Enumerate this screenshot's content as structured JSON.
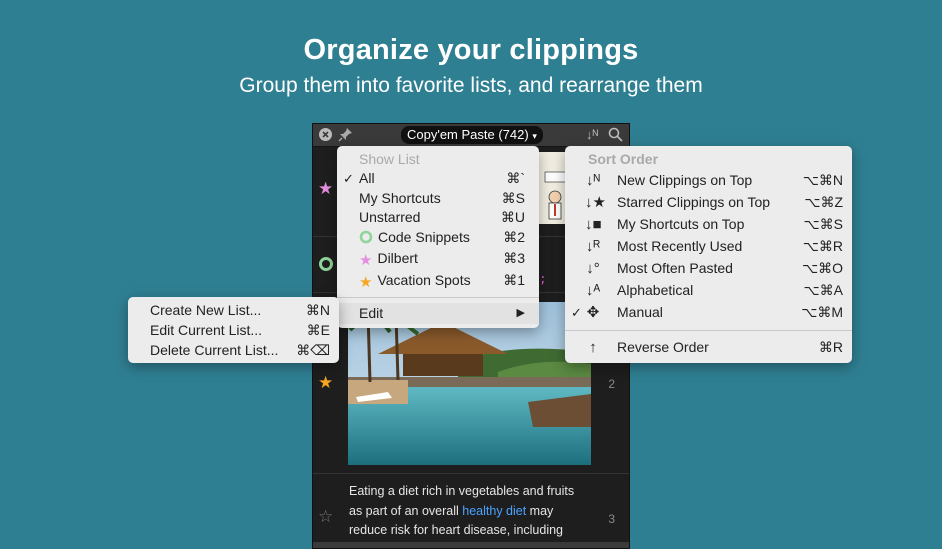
{
  "headline": {
    "title": "Organize your clippings",
    "subtitle": "Group them into favorite lists, and rearrange them"
  },
  "window": {
    "title": "Copy'em Paste (742)",
    "title_arrow": "▾",
    "close_glyph": "✕",
    "pin_glyph": "📌",
    "sort_glyph": "↓ᴺ",
    "search_glyph": "⌕"
  },
  "clips": {
    "code_fragment": "0;",
    "row_numbers": [
      "2",
      "3"
    ],
    "text_clip": {
      "before": "Eating a diet rich in vegetables and fruits as part of an overall ",
      "link": "healthy diet",
      "after": " may reduce risk for heart disease, including"
    }
  },
  "show_list_menu": {
    "header": "Show List",
    "items": [
      {
        "label": "All",
        "shortcut": "⌘`",
        "checked": true,
        "icon": ""
      },
      {
        "label": "My Shortcuts",
        "shortcut": "⌘S",
        "checked": false,
        "icon": ""
      },
      {
        "label": "Unstarred",
        "shortcut": "⌘U",
        "checked": false,
        "icon": ""
      },
      {
        "label": "Code Snippets",
        "shortcut": "⌘2",
        "checked": false,
        "icon": "green-ring-icon"
      },
      {
        "label": "Dilbert",
        "shortcut": "⌘3",
        "checked": false,
        "icon": "pink-star-icon"
      },
      {
        "label": "Vacation Spots",
        "shortcut": "⌘1",
        "checked": false,
        "icon": "orange-star-icon"
      }
    ],
    "edit_label": "Edit",
    "edit_arrow": "▶"
  },
  "edit_submenu": {
    "items": [
      {
        "label": "Create New List...",
        "shortcut": "⌘N"
      },
      {
        "label": "Edit Current List...",
        "shortcut": "⌘E"
      },
      {
        "label": "Delete Current List...",
        "shortcut": "⌘⌫"
      }
    ]
  },
  "sort_menu": {
    "header": "Sort Order",
    "items": [
      {
        "label": "New Clippings on Top",
        "shortcut": "⌥⌘N",
        "icon": "↓ᴺ",
        "checked": false
      },
      {
        "label": "Starred Clippings on Top",
        "shortcut": "⌥⌘Z",
        "icon": "↓★",
        "checked": false
      },
      {
        "label": "My Shortcuts on Top",
        "shortcut": "⌥⌘S",
        "icon": "↓■",
        "checked": false
      },
      {
        "label": "Most Recently Used",
        "shortcut": "⌥⌘R",
        "icon": "↓ᴿ",
        "checked": false
      },
      {
        "label": "Most Often Pasted",
        "shortcut": "⌥⌘O",
        "icon": "↓°",
        "checked": false
      },
      {
        "label": "Alphabetical",
        "shortcut": "⌥⌘A",
        "icon": "↓ᴬ",
        "checked": false
      },
      {
        "label": "Manual",
        "shortcut": "⌥⌘M",
        "icon": "✥",
        "checked": true
      }
    ],
    "reverse_label": "Reverse Order",
    "reverse_shortcut": "⌘R",
    "reverse_icon": "↑"
  },
  "colors": {
    "background": "#2f7f93",
    "link": "#4aa3ff",
    "star_pink": "#e58ee0",
    "star_orange": "#f5a623",
    "ring_green": "#8fd49a"
  }
}
